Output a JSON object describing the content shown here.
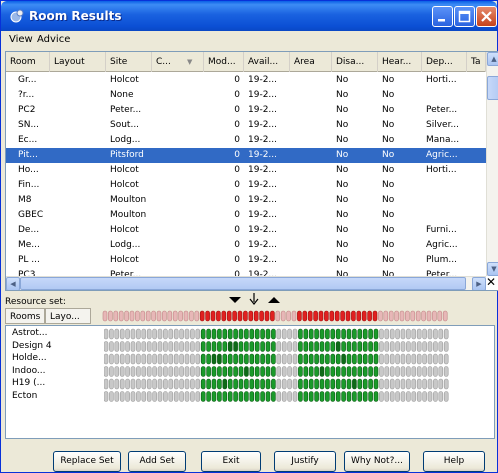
{
  "window": {
    "title": "Room Results"
  },
  "menu": {
    "view": "View",
    "advice": "Advice"
  },
  "columns": [
    "Room",
    "Layout",
    "Site",
    "C...",
    "Mod...",
    "Avail...",
    "Area",
    "Disa...",
    "Hear...",
    "Dep...",
    "Ta"
  ],
  "rows": [
    [
      "Gr...",
      "",
      "Holcot",
      "",
      "0",
      "19-2...",
      "",
      "No",
      "No",
      "Horti..."
    ],
    [
      "?r...",
      "",
      "None",
      "",
      "0",
      "19-2...",
      "",
      "No",
      "No",
      ""
    ],
    [
      "PC2",
      "",
      "Peter...",
      "",
      "0",
      "19-2...",
      "",
      "No",
      "No",
      "Peter..."
    ],
    [
      "SN...",
      "",
      "Sout...",
      "",
      "0",
      "19-2...",
      "",
      "No",
      "No",
      "Silver..."
    ],
    [
      "Ec...",
      "",
      "Lodg...",
      "",
      "0",
      "19-2...",
      "",
      "No",
      "No",
      "Mana..."
    ],
    [
      "Pit...",
      "",
      "Pitsford",
      "",
      "0",
      "19-2...",
      "",
      "No",
      "No",
      "Agric..."
    ],
    [
      "Ho...",
      "",
      "Holcot",
      "",
      "0",
      "19-2...",
      "",
      "No",
      "No",
      "Horti..."
    ],
    [
      "Fin...",
      "",
      "Holcot",
      "",
      "0",
      "19-2...",
      "",
      "No",
      "No",
      ""
    ],
    [
      "M8",
      "",
      "Moulton",
      "",
      "0",
      "19-2...",
      "",
      "No",
      "No",
      ""
    ],
    [
      "GBEC",
      "",
      "Moulton",
      "",
      "0",
      "19-2...",
      "",
      "No",
      "No",
      ""
    ],
    [
      "De...",
      "",
      "Holcot",
      "",
      "0",
      "19-2...",
      "",
      "No",
      "No",
      "Furni..."
    ],
    [
      "Me...",
      "",
      "Lodg...",
      "",
      "0",
      "19-2...",
      "",
      "No",
      "No",
      "Agric..."
    ],
    [
      "PL ...",
      "",
      "Holcot",
      "",
      "0",
      "19-2...",
      "",
      "No",
      "No",
      "Plum..."
    ],
    [
      "PC3",
      "",
      "Peter...",
      "",
      "0",
      "19-2...",
      "",
      "No",
      "No",
      "Peter..."
    ]
  ],
  "selected_row": 5,
  "resource_set_label": "Resource set:",
  "resource_tabs": [
    "Rooms",
    "Layo..."
  ],
  "resources": [
    "Astrot...",
    "Design 4",
    "Holde...",
    "Indoo...",
    "H19 (...",
    "Ecton"
  ],
  "colors": {
    "title_bar": "#0a5fe6",
    "selection": "#316ac5",
    "slot_free": "#1a9a2a",
    "slot_busy": "#c8c8c8",
    "header_alert": "#e02020"
  },
  "buttons": {
    "replace_set": "Replace Set",
    "add_set": "Add Set",
    "exit": "Exit",
    "justify": "Justify",
    "why_not": "Why Not?...",
    "help": "Help"
  }
}
